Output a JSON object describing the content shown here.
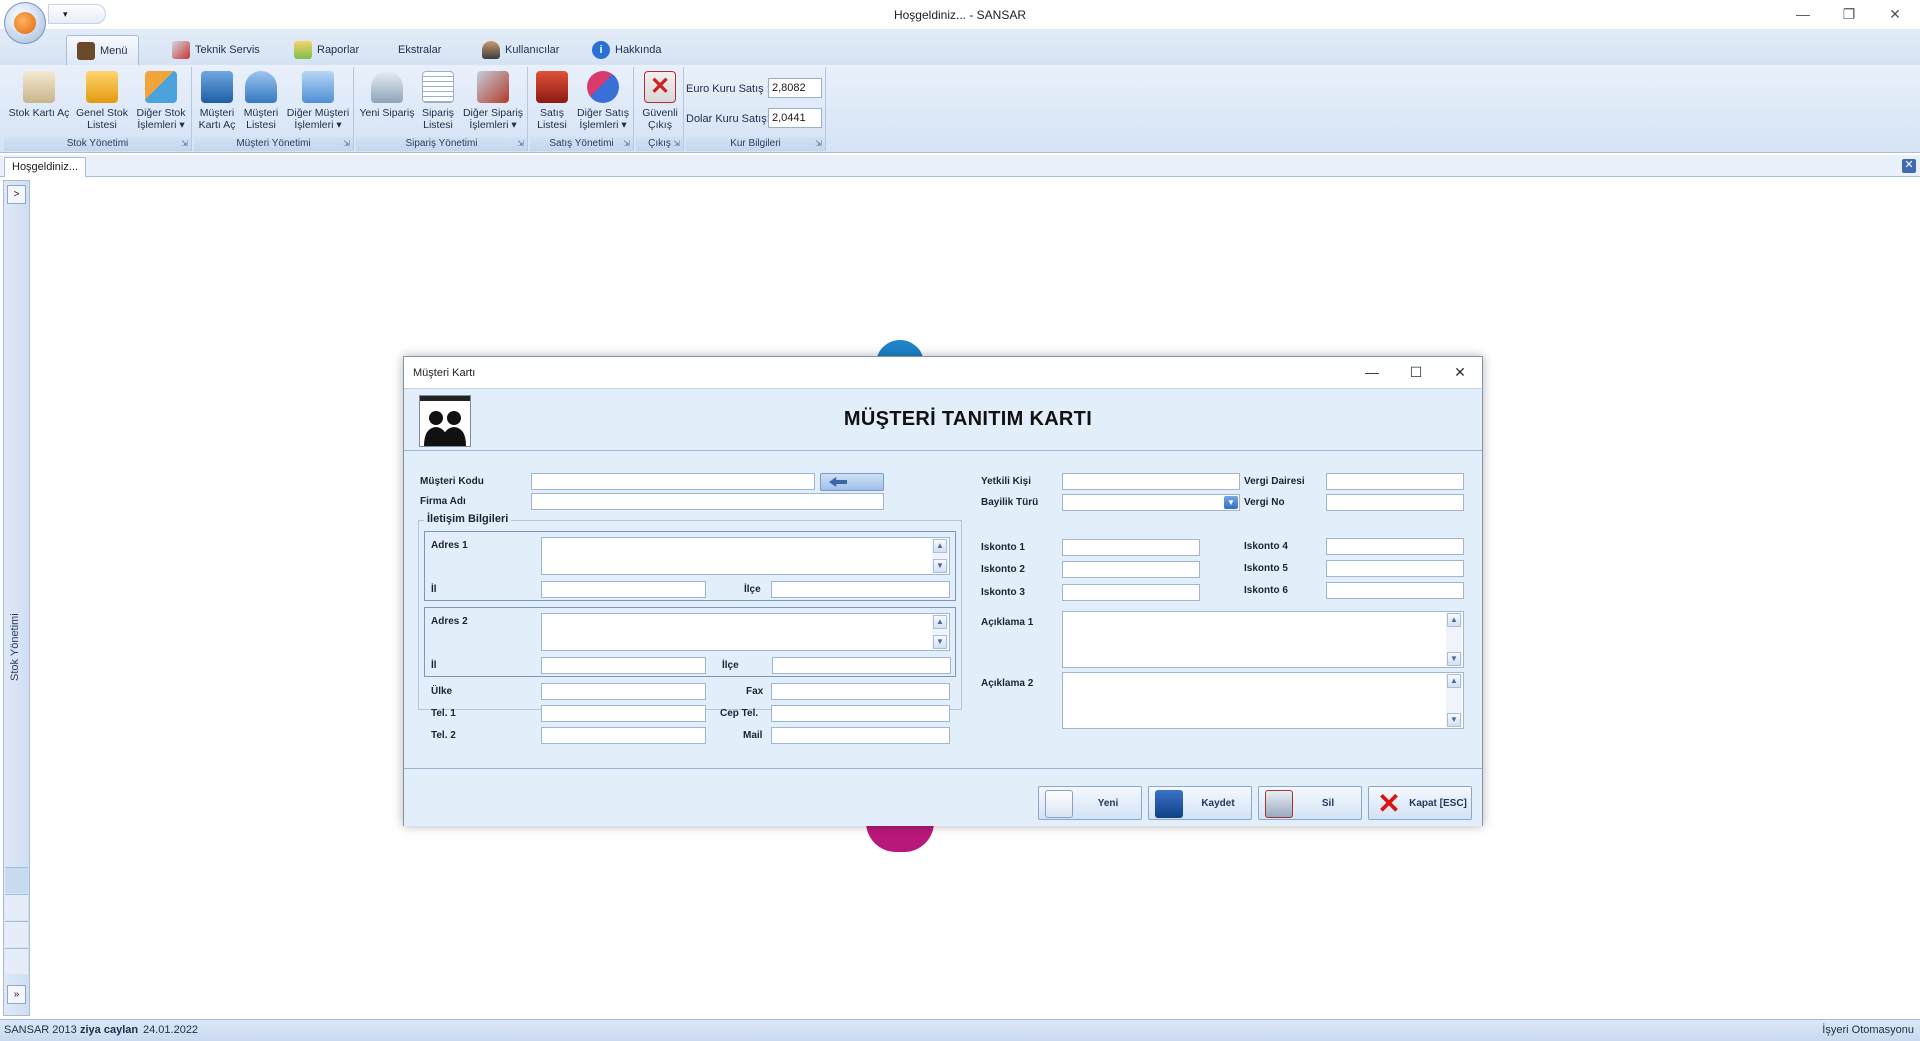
{
  "window": {
    "title": "Hoşgeldiniz... - SANSAR",
    "qat_arrow": "▾"
  },
  "ribbon": {
    "tabs": [
      {
        "label": "Menü",
        "icon": "home-book-icon"
      },
      {
        "label": "Teknik Servis",
        "icon": "tools-icon"
      },
      {
        "label": "Raporlar",
        "icon": "report-icon"
      },
      {
        "label": "Ekstralar",
        "icon": ""
      },
      {
        "label": "Kullanıcılar",
        "icon": "user-icon"
      },
      {
        "label": "Hakkında",
        "icon": "info-icon"
      }
    ],
    "groups": {
      "stok": {
        "caption": "Stok Yönetimi",
        "buttons": [
          {
            "line1": "Stok Kartı Aç",
            "line2": ""
          },
          {
            "line1": "Genel Stok",
            "line2": "Listesi"
          },
          {
            "line1": "Diğer Stok",
            "line2": "İşlemleri ▾"
          }
        ]
      },
      "musteri": {
        "caption": "Müşteri Yönetimi",
        "buttons": [
          {
            "line1": "Müşteri",
            "line2": "Kartı Aç"
          },
          {
            "line1": "Müşteri",
            "line2": "Listesi"
          },
          {
            "line1": "Diğer Müşteri",
            "line2": "İşlemleri ▾"
          }
        ]
      },
      "siparis": {
        "caption": "Sipariş Yönetimi",
        "buttons": [
          {
            "line1": "Yeni Sipariş",
            "line2": ""
          },
          {
            "line1": "Sipariş",
            "line2": "Listesi"
          },
          {
            "line1": "Diğer Sipariş",
            "line2": "İşlemleri ▾"
          }
        ]
      },
      "satis": {
        "caption": "Satış Yönetimi",
        "buttons": [
          {
            "line1": "Satış",
            "line2": "Listesi"
          },
          {
            "line1": "Diğer Satış",
            "line2": "İşlemleri ▾"
          }
        ]
      },
      "cikis": {
        "caption": "Çıkış",
        "buttons": [
          {
            "line1": "Güvenli",
            "line2": "Çıkış"
          }
        ]
      },
      "kur": {
        "caption": "Kur Bilgileri",
        "euro_label": "Euro Kuru Satış :",
        "euro_value": "2,8082",
        "dolar_label": "Dolar Kuru Satış:",
        "dolar_value": "2,0441"
      },
      "launcher_glyph": "⇲"
    }
  },
  "doc_tabs": {
    "active": "Hoşgeldiniz...",
    "close_glyph": "✕"
  },
  "left_nav": {
    "label": "Stok Yönetimi",
    "expand_glyph": ">",
    "more_glyph": "»"
  },
  "dialog": {
    "title": "Müşteri Kartı",
    "heading": "MÜŞTERİ TANITIM KARTI",
    "fields": {
      "musteri_kodu": "Müşteri Kodu",
      "firma_adi": "Firma Adı",
      "iletisim": "İletişim Bilgileri",
      "adres1": "Adres 1",
      "il": "İl",
      "ilce": "İlçe",
      "adres2": "Adres 2",
      "ulke": "Ülke",
      "fax": "Fax",
      "tel1": "Tel. 1",
      "cep_tel": "Cep Tel.",
      "tel2": "Tel. 2",
      "mail": "Mail",
      "yetkili_kisi": "Yetkili Kişi",
      "vergi_dairesi": "Vergi Dairesi",
      "bayilik_turu": "Bayilik Türü",
      "vergi_no": "Vergi No",
      "iskonto1": "Iskonto 1",
      "iskonto2": "Iskonto 2",
      "iskonto3": "Iskonto 3",
      "iskonto4": "Iskonto 4",
      "iskonto5": "Iskonto 5",
      "iskonto6": "Iskonto 6",
      "aciklama1": "Açıklama 1",
      "aciklama2": "Açıklama 2"
    },
    "values": {
      "musteri_kodu": "",
      "firma_adi": "",
      "il1": "",
      "ilce1": "",
      "il2": "",
      "ilce2": "",
      "ulke": "",
      "fax": "",
      "tel1": "",
      "cep_tel": "",
      "tel2": "",
      "mail": "",
      "yetkili_kisi": "",
      "vergi_dairesi": "",
      "bayilik_turu": "",
      "vergi_no": "",
      "iskonto1": "",
      "iskonto2": "",
      "iskonto3": "",
      "iskonto4": "",
      "iskonto5": "",
      "iskonto6": ""
    },
    "buttons": {
      "yeni": "Yeni",
      "kaydet": "Kaydet",
      "sil": "Sil",
      "kapat": "Kapat [ESC]"
    },
    "scroll_up_glyph": "▲",
    "scroll_down_glyph": "▼",
    "combo_glyph": "▼"
  },
  "status": {
    "app": "SANSAR 2013",
    "user": "ziya caylan",
    "date": "24.01.2022",
    "right": "İşyeri Otomasyonu"
  },
  "colors": {
    "accent": "#3e6ab3",
    "ribbon_bg": "#d5e3f5",
    "dialog_bg": "#e3eefb"
  }
}
